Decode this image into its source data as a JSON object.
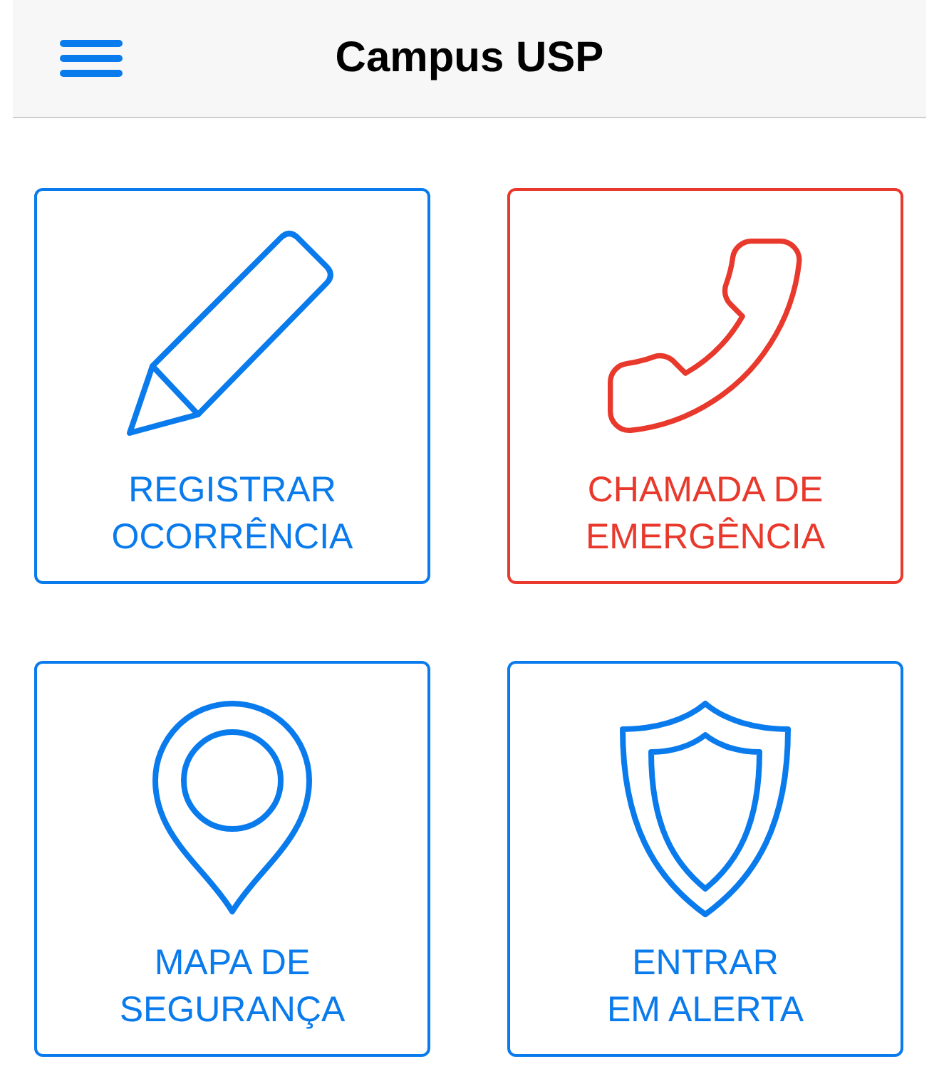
{
  "header": {
    "title": "Campus USP"
  },
  "cards": [
    {
      "kind": "pencil",
      "label": "REGISTRAR\nOCORRÊNCIA",
      "color": "#0a7bec"
    },
    {
      "kind": "phone",
      "label": "CHAMADA DE\nEMERGÊNCIA",
      "color": "#e8392c"
    },
    {
      "kind": "pin",
      "label": "MAPA DE\nSEGURANÇA",
      "color": "#0a7bec"
    },
    {
      "kind": "shield",
      "label": "ENTRAR\nEM ALERTA",
      "color": "#0a7bec"
    }
  ]
}
